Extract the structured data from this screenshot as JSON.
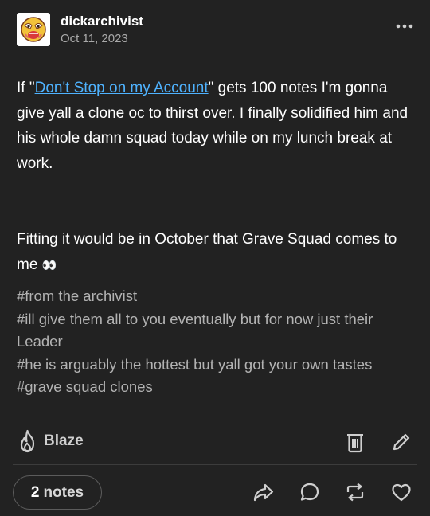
{
  "post": {
    "username": "dickarchivist",
    "date": "Oct 11, 2023",
    "body": {
      "p1_before": "If \"",
      "p1_link": "Don't Stop on my Account",
      "p1_after": "\" gets 100 notes I'm gonna give yall a clone oc to thirst over. I finally solidified him and his whole damn squad today while on my lunch break at work.",
      "p2_text": "Fitting it would be in October that Grave Squad comes to me",
      "p2_emoji": "👀"
    },
    "tags": [
      "#from the archivist",
      "#ill give them all to you eventually but for now just their Leader",
      "#he is arguably the hottest but yall got your own tastes",
      "#grave squad clones"
    ]
  },
  "actions": {
    "blaze_label": "Blaze",
    "notes_count": "2",
    "notes_word": "notes"
  },
  "colors": {
    "background": "#222222",
    "link": "#4fb3ff",
    "tag": "#b3b3b3"
  },
  "icons": [
    "avatar",
    "more-icon",
    "blaze-icon",
    "trash-icon",
    "edit-icon",
    "share-icon",
    "reply-icon",
    "reblog-icon",
    "like-icon"
  ]
}
